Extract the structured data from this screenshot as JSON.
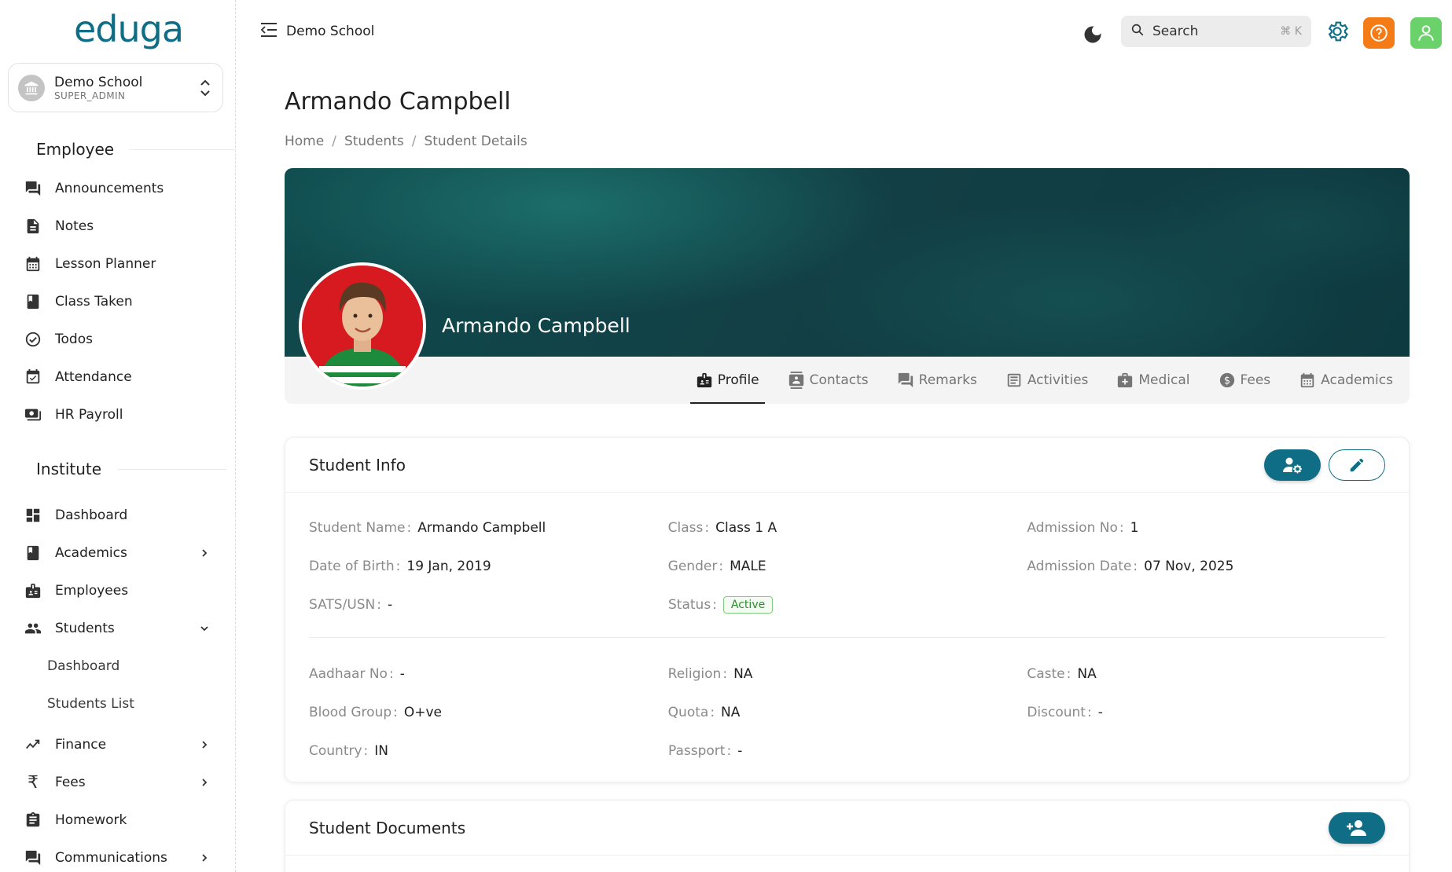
{
  "app": {
    "logo_text": "eduga",
    "title": "Demo School"
  },
  "school_switcher": {
    "name": "Demo School",
    "role": "SUPER_ADMIN"
  },
  "sidebar": {
    "sections": [
      {
        "title": "Employee"
      },
      {
        "title": "Institute"
      }
    ],
    "employee_items": [
      {
        "label": "Announcements",
        "icon": "forum-icon"
      },
      {
        "label": "Notes",
        "icon": "note-icon"
      },
      {
        "label": "Lesson Planner",
        "icon": "calendar-grid-icon"
      },
      {
        "label": "Class Taken",
        "icon": "book-icon"
      },
      {
        "label": "Todos",
        "icon": "check-circle-icon"
      },
      {
        "label": "Attendance",
        "icon": "calendar-check-icon"
      },
      {
        "label": "HR Payroll",
        "icon": "payroll-icon"
      }
    ],
    "institute_items": [
      {
        "label": "Dashboard",
        "icon": "dashboard-icon"
      },
      {
        "label": "Academics",
        "icon": "book-icon"
      },
      {
        "label": "Employees",
        "icon": "badge-icon"
      },
      {
        "label": "Students",
        "icon": "people-icon"
      },
      {
        "label": "Finance",
        "icon": "trending-icon"
      },
      {
        "label": "Fees",
        "icon": "rupee-icon"
      },
      {
        "label": "Homework",
        "icon": "clipboard-icon"
      },
      {
        "label": "Communications",
        "icon": "forum-icon"
      }
    ],
    "students_sub": [
      "Dashboard",
      "Students List"
    ]
  },
  "topbar": {
    "school": "Demo School",
    "search_label": "Search",
    "search_shortcut": "⌘ K"
  },
  "page": {
    "title": "Armando Campbell",
    "breadcrumb": [
      "Home",
      "Students",
      "Student Details"
    ]
  },
  "profile": {
    "name": "Armando Campbell",
    "tabs": [
      {
        "label": "Profile",
        "active": true
      },
      {
        "label": "Contacts"
      },
      {
        "label": "Remarks"
      },
      {
        "label": "Activities"
      },
      {
        "label": "Medical"
      },
      {
        "label": "Fees"
      },
      {
        "label": "Academics"
      }
    ]
  },
  "student_info": {
    "title": "Student Info",
    "rows": [
      [
        {
          "label": "Student Name",
          "value": "Armando Campbell"
        },
        {
          "label": "Class",
          "value": "Class 1 A"
        },
        {
          "label": "Admission No",
          "value": "1"
        }
      ],
      [
        {
          "label": "Date of Birth",
          "value": "19 Jan, 2019"
        },
        {
          "label": "Gender",
          "value": "MALE"
        },
        {
          "label": "Admission Date",
          "value": "07 Nov, 2025"
        }
      ],
      [
        {
          "label": "SATS/USN",
          "value": "-"
        },
        {
          "label": "Status",
          "value": "Active"
        }
      ],
      [
        {
          "label": "Aadhaar No",
          "value": "-"
        },
        {
          "label": "Religion",
          "value": "NA"
        },
        {
          "label": "Caste",
          "value": "NA"
        }
      ],
      [
        {
          "label": "Blood Group",
          "value": "O+ve"
        },
        {
          "label": "Quota",
          "value": "NA"
        },
        {
          "label": "Discount",
          "value": "-"
        }
      ],
      [
        {
          "label": "Country",
          "value": "IN"
        },
        {
          "label": "Passport",
          "value": "-"
        }
      ]
    ]
  },
  "documents": {
    "title": "Student Documents"
  },
  "colors": {
    "brand": "#0f6e86",
    "help": "#f47b16",
    "user": "#6bd16b",
    "status": "#2e8b2e"
  }
}
